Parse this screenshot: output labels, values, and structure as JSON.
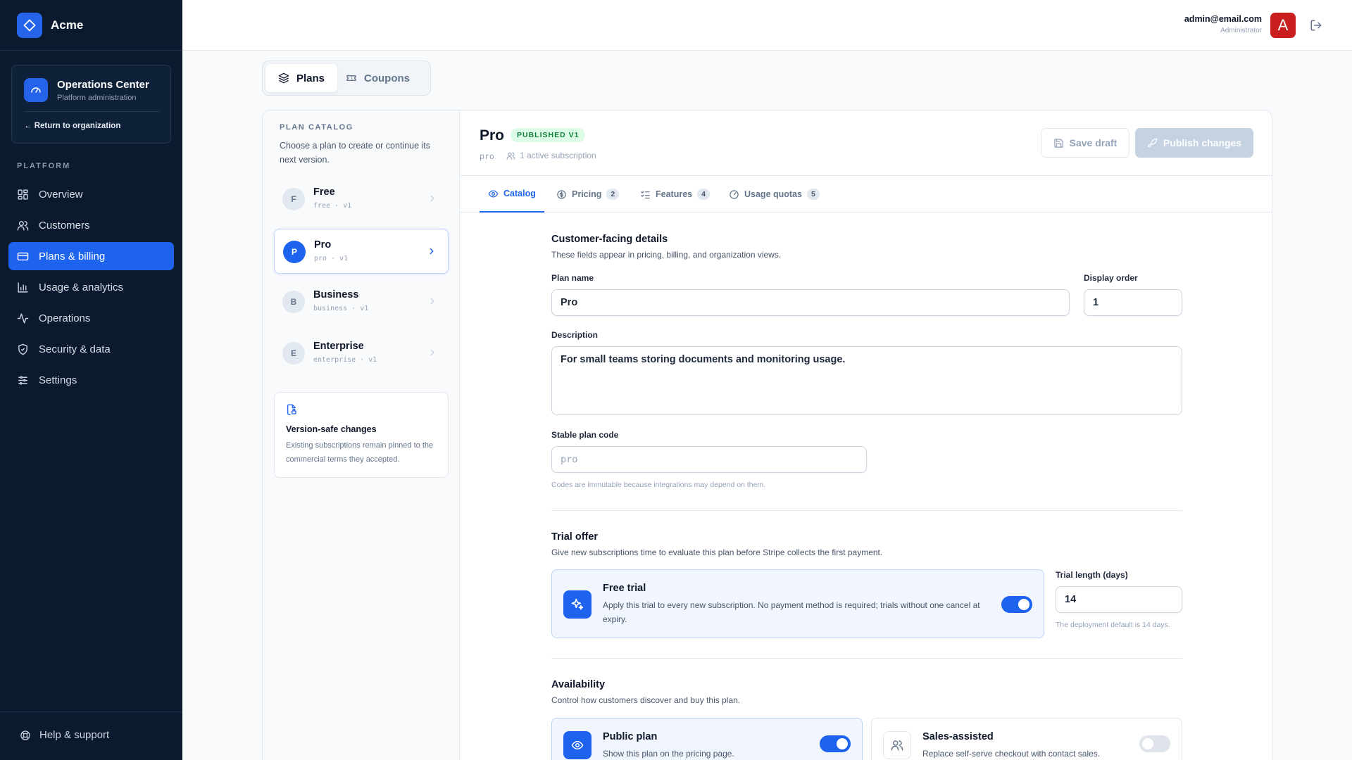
{
  "brand": {
    "name": "Acme"
  },
  "ops_center": {
    "title": "Operations Center",
    "subtitle": "Platform administration",
    "return_link": "← Return to organization"
  },
  "sidebar": {
    "section_label": "PLATFORM",
    "items": [
      {
        "label": "Overview",
        "icon": "grid-icon"
      },
      {
        "label": "Customers",
        "icon": "users-icon"
      },
      {
        "label": "Plans & billing",
        "icon": "credit-card-icon",
        "active": true
      },
      {
        "label": "Usage & analytics",
        "icon": "bar-chart-icon"
      },
      {
        "label": "Operations",
        "icon": "activity-icon"
      },
      {
        "label": "Security & data",
        "icon": "shield-icon"
      },
      {
        "label": "Settings",
        "icon": "sliders-icon"
      }
    ],
    "help": "Help & support"
  },
  "user": {
    "email": "admin@email.com",
    "role": "Administrator",
    "avatar_letter": "A"
  },
  "top_tabs": [
    {
      "label": "Plans",
      "active": true
    },
    {
      "label": "Coupons",
      "active": false
    }
  ],
  "catalog": {
    "label": "PLAN CATALOG",
    "description": "Choose a plan to create or continue its next version.",
    "plans": [
      {
        "initial": "F",
        "name": "Free",
        "code": "free · v1"
      },
      {
        "initial": "P",
        "name": "Pro",
        "code": "pro · v1",
        "active": true
      },
      {
        "initial": "B",
        "name": "Business",
        "code": "business · v1"
      },
      {
        "initial": "E",
        "name": "Enterprise",
        "code": "enterprise · v1"
      }
    ],
    "safe_card": {
      "title": "Version-safe changes",
      "description": "Existing subscriptions remain pinned to the commercial terms they accepted."
    }
  },
  "editor": {
    "title": "Pro",
    "badge": "PUBLISHED V1",
    "code": "pro",
    "subscriptions": "1 active subscription",
    "save_draft": "Save draft",
    "publish": "Publish changes",
    "tabs": [
      {
        "label": "Catalog",
        "count": null,
        "active": true
      },
      {
        "label": "Pricing",
        "count": "2"
      },
      {
        "label": "Features",
        "count": "4"
      },
      {
        "label": "Usage quotas",
        "count": "5"
      }
    ],
    "details": {
      "title": "Customer-facing details",
      "subtitle": "These fields appear in pricing, billing, and organization views.",
      "plan_name_label": "Plan name",
      "plan_name_value": "Pro",
      "display_order_label": "Display order",
      "display_order_value": "1",
      "description_label": "Description",
      "description_value": "For small teams storing documents and monitoring usage.",
      "code_label": "Stable plan code",
      "code_value": "pro",
      "code_hint": "Codes are immutable because integrations may depend on them."
    },
    "trial": {
      "title": "Trial offer",
      "subtitle": "Give new subscriptions time to evaluate this plan before Stripe collects the first payment.",
      "option_title": "Free trial",
      "option_desc": "Apply this trial to every new subscription. No payment method is required; trials without one cancel at expiry.",
      "enabled": true,
      "length_label": "Trial length (days)",
      "length_value": "14",
      "length_hint": "The deployment default is 14 days."
    },
    "availability": {
      "title": "Availability",
      "subtitle": "Control how customers discover and buy this plan.",
      "public_title": "Public plan",
      "public_desc": "Show this plan on the pricing page.",
      "public_enabled": true,
      "sales_title": "Sales-assisted",
      "sales_desc": "Replace self-serve checkout with contact sales.",
      "sales_enabled": false
    }
  },
  "colors": {
    "accent": "#1d63ed",
    "sidebar_bg": "#0b1a2e",
    "success": "#15803d",
    "avatar": "#c81e1e"
  }
}
